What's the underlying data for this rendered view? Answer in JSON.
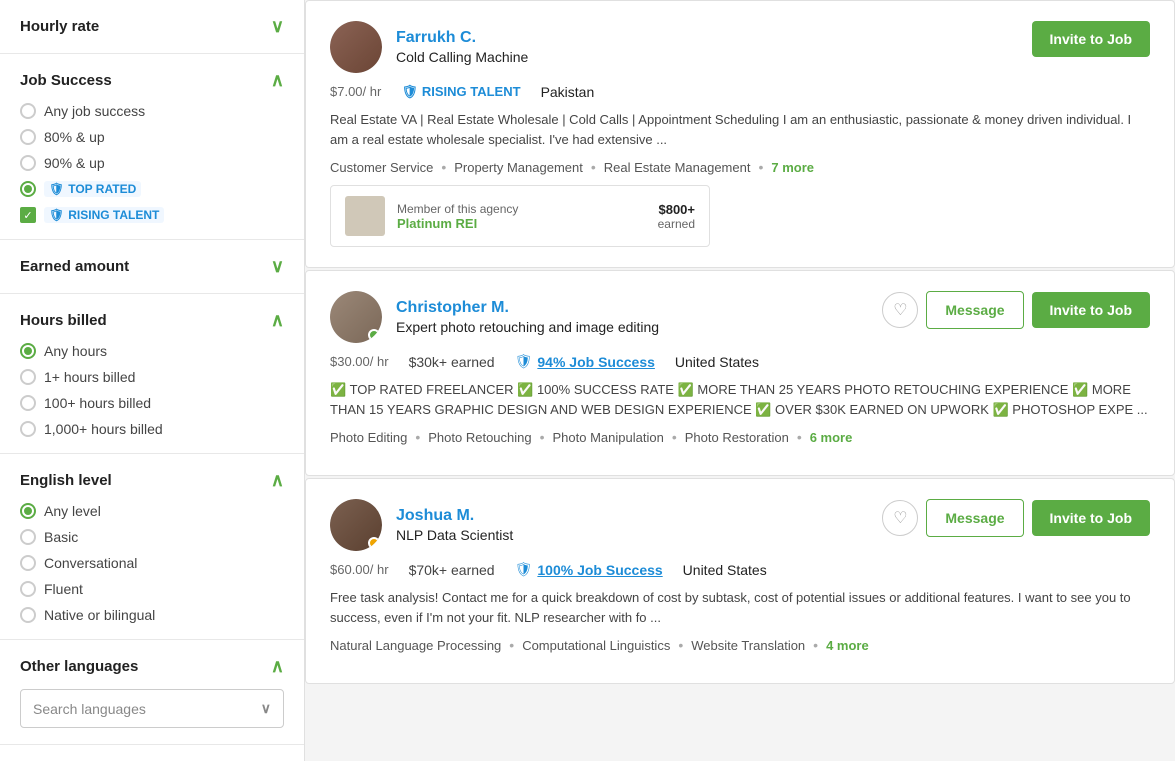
{
  "sidebar": {
    "sections": [
      {
        "id": "hourly-rate",
        "title": "Hourly rate",
        "chevron": "expanded",
        "chevron_symbol": "∨"
      },
      {
        "id": "job-success",
        "title": "Job Success",
        "chevron": "expanded",
        "chevron_symbol": "∧",
        "options": [
          {
            "label": "Any job success",
            "selected": false
          },
          {
            "label": "80% & up",
            "selected": false
          },
          {
            "label": "90% & up",
            "selected": false
          },
          {
            "label": "TOP RATED",
            "selected": true,
            "badge": "top-rated"
          },
          {
            "label": "RISING TALENT",
            "selected": true,
            "badge": "rising-talent"
          }
        ]
      },
      {
        "id": "earned-amount",
        "title": "Earned amount",
        "chevron": "collapsed",
        "chevron_symbol": "∨"
      },
      {
        "id": "hours-billed",
        "title": "Hours billed",
        "chevron": "expanded",
        "chevron_symbol": "∧",
        "options": [
          {
            "label": "Any hours",
            "selected": true
          },
          {
            "label": "1+ hours billed",
            "selected": false
          },
          {
            "label": "100+ hours billed",
            "selected": false
          },
          {
            "label": "1,000+ hours billed",
            "selected": false
          }
        ]
      },
      {
        "id": "english-level",
        "title": "English level",
        "chevron": "expanded",
        "chevron_symbol": "∧",
        "options": [
          {
            "label": "Any level",
            "selected": true
          },
          {
            "label": "Basic",
            "selected": false
          },
          {
            "label": "Conversational",
            "selected": false
          },
          {
            "label": "Fluent",
            "selected": false
          },
          {
            "label": "Native or bilingual",
            "selected": false
          }
        ]
      },
      {
        "id": "other-languages",
        "title": "Other languages",
        "chevron": "expanded",
        "chevron_symbol": "∧",
        "search_placeholder": "Search languages"
      }
    ]
  },
  "freelancers": [
    {
      "id": "farrukh",
      "name": "Farrukh C.",
      "title": "Cold Calling Machine",
      "rate": "$7.00",
      "rate_unit": "/ hr",
      "earned": null,
      "job_success": null,
      "location": "Pakistan",
      "badge": "RISING TALENT",
      "badge_type": "rising",
      "description": "Real Estate VA | Real Estate Wholesale | Cold Calls | Appointment Scheduling I am an enthusiastic, passionate & money driven individual. I am a real estate wholesale specialist. I've had extensive ...",
      "skills": [
        "Customer Service",
        "Property Management",
        "Real Estate Management"
      ],
      "more_skills": "7 more",
      "agency": {
        "label": "Member of this agency",
        "name": "Platinum REI",
        "earned": "$800+",
        "earned_label": "earned"
      },
      "has_heart": false,
      "has_message": false,
      "invite_label": "Invite to Job"
    },
    {
      "id": "christopher",
      "name": "Christopher M.",
      "title": "Expert photo retouching and image editing",
      "rate": "$30.00",
      "rate_unit": "/ hr",
      "earned": "$30k+",
      "earned_label": "earned",
      "job_success": "94% Job Success",
      "location": "United States",
      "badge": null,
      "description": "✅ TOP RATED FREELANCER ✅ 100% SUCCESS RATE ✅ MORE THAN 25 YEARS PHOTO RETOUCHING EXPERIENCE ✅ MORE THAN 15 YEARS GRAPHIC DESIGN AND WEB DESIGN EXPERIENCE ✅ OVER $30K EARNED ON UPWORK ✅ PHOTOSHOP EXPE ...",
      "skills": [
        "Photo Editing",
        "Photo Retouching",
        "Photo Manipulation",
        "Photo Restoration"
      ],
      "more_skills": "6 more",
      "agency": null,
      "has_heart": true,
      "has_message": true,
      "invite_label": "Invite to Job",
      "message_label": "Message"
    },
    {
      "id": "joshua",
      "name": "Joshua M.",
      "title": "NLP Data Scientist",
      "rate": "$60.00",
      "rate_unit": "/ hr",
      "earned": "$70k+",
      "earned_label": "earned",
      "job_success": "100% Job Success",
      "location": "United States",
      "badge": null,
      "description": "Free task analysis! Contact me for a quick breakdown of cost by subtask, cost of potential issues or additional features. I want to see you to success, even if I'm not your fit. NLP researcher with fo ...",
      "skills": [
        "Natural Language Processing",
        "Computational Linguistics",
        "Website Translation"
      ],
      "more_skills": "4 more",
      "agency": null,
      "has_heart": true,
      "has_message": true,
      "invite_label": "Invite to Job",
      "message_label": "Message"
    }
  ],
  "colors": {
    "green": "#5bac44",
    "blue": "#1d8cd7",
    "text_dark": "#222",
    "text_mid": "#555",
    "border": "#e0e0e0"
  }
}
